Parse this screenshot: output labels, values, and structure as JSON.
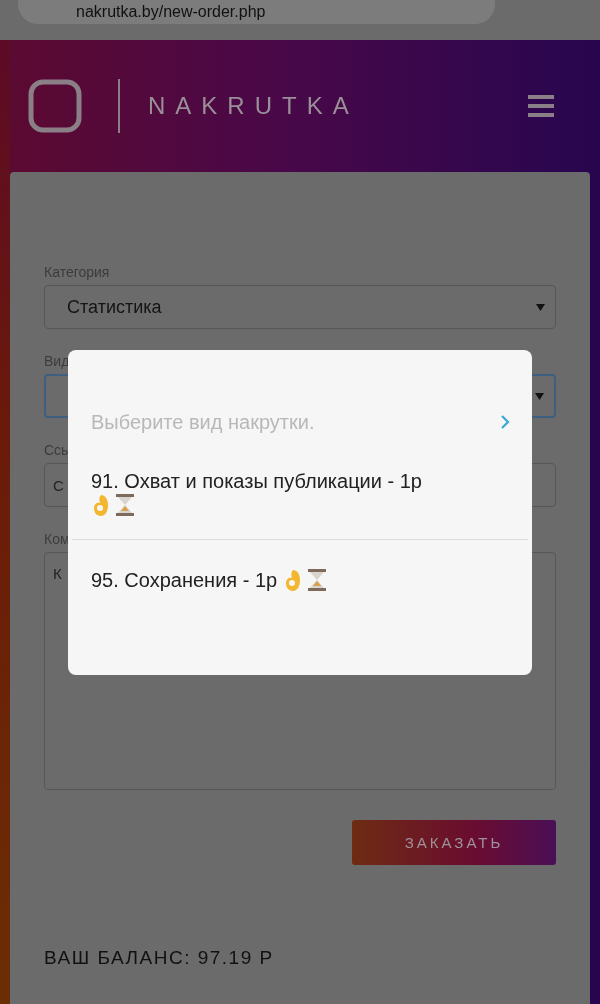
{
  "browser": {
    "url": "nakrutka.by/new-order.php"
  },
  "header": {
    "brand": "NAKRUTKA"
  },
  "form": {
    "fields": [
      {
        "kind": "select",
        "label": "Категория",
        "value": "Статистика",
        "focused": false
      },
      {
        "kind": "select",
        "label": "Вид",
        "focused": true
      },
      {
        "kind": "input",
        "label": "Ссы",
        "placeholder": "С",
        "focused": false
      },
      {
        "kind": "textarea",
        "label": "Ком",
        "placeholder": "К",
        "focused": false
      }
    ],
    "submit": "ЗАКАЗАТЬ",
    "balance": "ВАШ БАЛАНС: 97.19 Р"
  },
  "picker": {
    "prompt": "Выберите вид накрутки.",
    "options": [
      {
        "label": "91. Охват и показы публикации - 1р"
      },
      {
        "label": "95. Сохранения - 1р"
      }
    ]
  }
}
